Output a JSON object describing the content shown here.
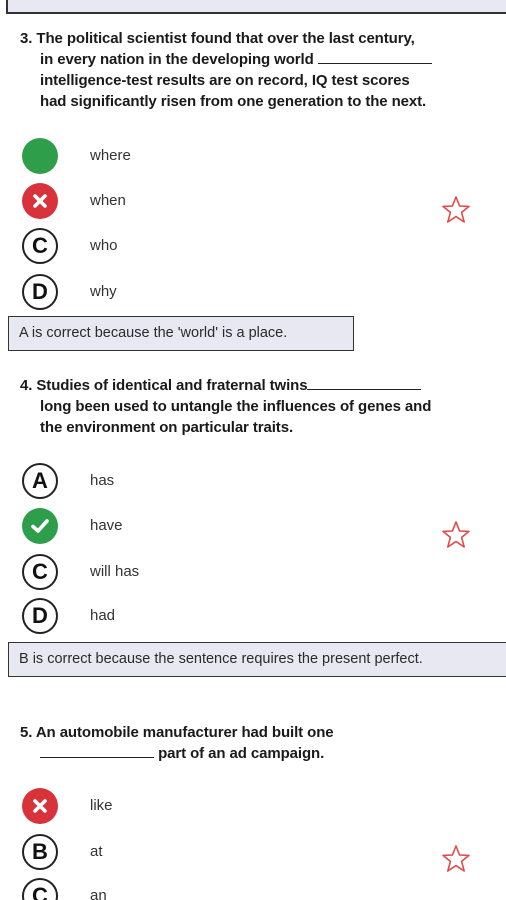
{
  "questions": [
    {
      "number": "3.",
      "line1": "The political scientist found that over the last century,",
      "line2a": "in every nation in the developing world",
      "line3": "intelligence-test results are on record, IQ test scores",
      "line4": "had significantly risen from one generation to the next.",
      "options": [
        {
          "badge": "",
          "state": "correct",
          "label": "where"
        },
        {
          "badge": "",
          "state": "wrong",
          "label": "when"
        },
        {
          "badge": "C",
          "state": "normal",
          "label": "who"
        },
        {
          "badge": "D",
          "state": "normal",
          "label": "why"
        }
      ],
      "explanation": "A is correct because the 'world' is a place."
    },
    {
      "number": "4.",
      "line1a": "Studies of identical and fraternal twins",
      "line2": "long been used to untangle the influences of genes and",
      "line3": "the environment on particular traits.",
      "options": [
        {
          "badge": "A",
          "state": "normal",
          "label": "has"
        },
        {
          "badge": "",
          "state": "correct",
          "label": "have"
        },
        {
          "badge": "C",
          "state": "normal",
          "label": "will has"
        },
        {
          "badge": "D",
          "state": "normal",
          "label": "had"
        }
      ],
      "explanation": "B is correct because the sentence requires the present perfect."
    },
    {
      "number": "5.",
      "line1": "An automobile manufacturer had built one",
      "line2b": "part of an ad campaign.",
      "options": [
        {
          "badge": "",
          "state": "wrong",
          "label": "like"
        },
        {
          "badge": "B",
          "state": "normal",
          "label": "at"
        },
        {
          "badge": "C",
          "state": "normal",
          "label": "an"
        }
      ]
    }
  ],
  "colors": {
    "correct": "#2e9e4a",
    "wrong": "#d8333a",
    "explanation_bg": "#e8e8f2",
    "star": "#e14a4a"
  },
  "icons": {
    "correct": "check-circle-icon",
    "wrong": "x-circle-icon",
    "bookmark": "star-outline-icon"
  }
}
